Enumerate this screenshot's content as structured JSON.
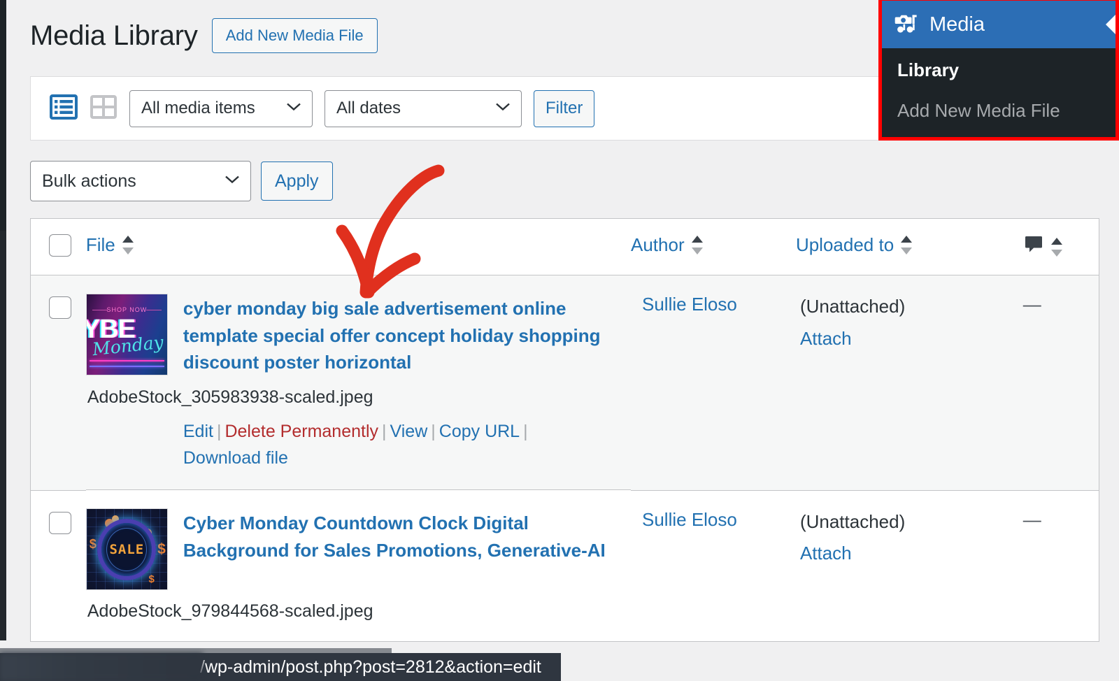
{
  "header": {
    "title": "Media Library",
    "add_new_label": "Add New Media File"
  },
  "filter_bar": {
    "list_view_icon": "list-view-icon",
    "grid_view_icon": "grid-view-icon",
    "media_type_value": "All media items",
    "dates_value": "All dates",
    "filter_label": "Filter"
  },
  "bulk_bar": {
    "bulk_actions_value": "Bulk actions",
    "apply_label": "Apply"
  },
  "table": {
    "columns": {
      "file": "File",
      "author": "Author",
      "uploaded_to": "Uploaded to",
      "comments_icon": "comment-bubble-icon"
    },
    "rows": [
      {
        "title": "cyber monday big sale advertisement online template special offer concept holiday shopping discount poster horizontal",
        "filename": "AdobeStock_305983938-scaled.jpeg",
        "actions": {
          "edit": "Edit",
          "delete": "Delete Permanently",
          "view": "View",
          "copy_url": "Copy URL",
          "download": "Download file"
        },
        "author": "Sullie Eloso",
        "uploaded_to": "(Unattached)",
        "attach_label": "Attach",
        "comments": "—"
      },
      {
        "title": "Cyber Monday Countdown Clock Digital Background for Sales Promotions, Generative-AI",
        "filename": "AdobeStock_979844568-scaled.jpeg",
        "author": "Sullie Eloso",
        "uploaded_to": "(Unattached)",
        "attach_label": "Attach",
        "comments": "—"
      }
    ]
  },
  "media_menu": {
    "icon": "media-camera-note-icon",
    "header_label": "Media",
    "items": [
      {
        "label": "Library",
        "active": true
      },
      {
        "label": "Add New Media File",
        "active": false
      }
    ],
    "highlight_color": "#ff0000",
    "header_color": "#2c6eb5",
    "background_color": "#1d2327"
  },
  "annotation": {
    "type": "hand-drawn-arrow",
    "color": "#e0301e"
  },
  "status_bar": {
    "url": "/wp-admin/post.php?post=2812&action=edit",
    "redacted_prefix": true
  },
  "colors": {
    "link": "#2271b1",
    "danger": "#b32d2e",
    "page_bg": "#f0f0f1",
    "row_alt_bg": "#f6f7f7"
  }
}
